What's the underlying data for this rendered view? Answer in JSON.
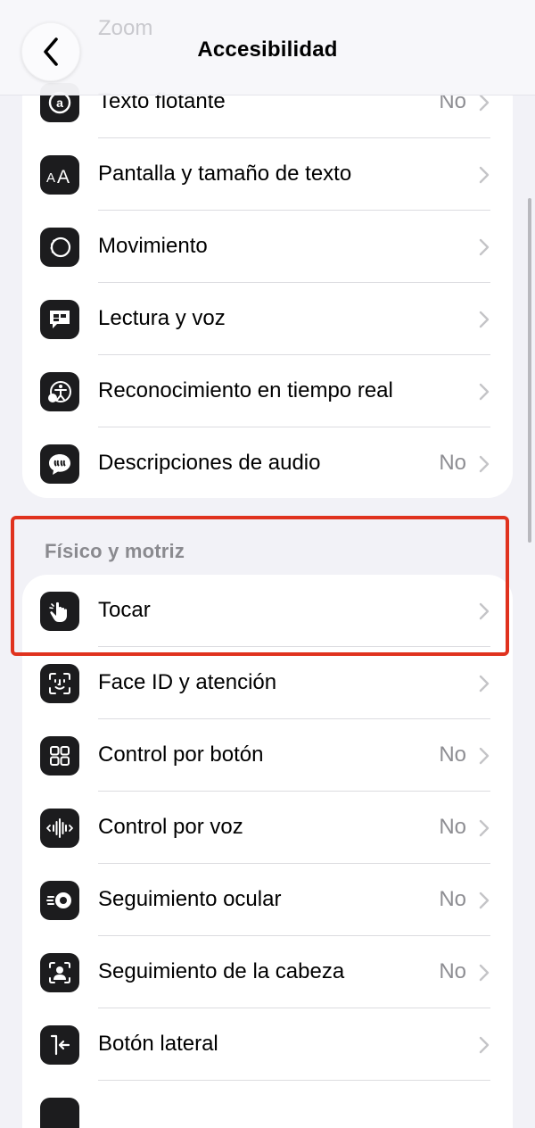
{
  "nav": {
    "title": "Accesibilidad",
    "back_label": "",
    "ghost_label": "Zoom"
  },
  "group1": {
    "items": [
      {
        "label": "Texto flotante",
        "value": "No",
        "icon": "floating-text-icon"
      },
      {
        "label": "Pantalla y tamaño de texto",
        "value": "",
        "icon": "text-size-icon"
      },
      {
        "label": "Movimiento",
        "value": "",
        "icon": "motion-icon"
      },
      {
        "label": "Lectura y voz",
        "value": "",
        "icon": "speech-bubble-icon"
      },
      {
        "label": "Reconocimiento en tiempo real",
        "value": "",
        "icon": "live-recognition-icon"
      },
      {
        "label": "Descripciones de audio",
        "value": "No",
        "icon": "audio-description-icon"
      }
    ]
  },
  "group2": {
    "header": "Físico y motriz",
    "items": [
      {
        "label": "Tocar",
        "value": "",
        "icon": "touch-hand-icon"
      },
      {
        "label": "Face ID y atención",
        "value": "",
        "icon": "face-id-icon"
      },
      {
        "label": "Control por botón",
        "value": "No",
        "icon": "switch-control-icon"
      },
      {
        "label": "Control por voz",
        "value": "No",
        "icon": "voice-control-icon"
      },
      {
        "label": "Seguimiento ocular",
        "value": "No",
        "icon": "eye-tracking-icon"
      },
      {
        "label": "Seguimiento de la cabeza",
        "value": "No",
        "icon": "head-tracking-icon"
      },
      {
        "label": "Botón lateral",
        "value": "",
        "icon": "side-button-icon"
      }
    ]
  },
  "colors": {
    "background": "#f2f2f7",
    "card": "#ffffff",
    "icon_tile": "#1c1c1e",
    "secondary_text": "#8e8e93",
    "highlight": "#e0321e"
  }
}
